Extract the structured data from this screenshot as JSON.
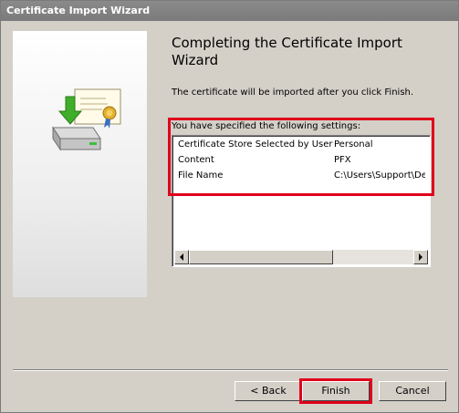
{
  "window": {
    "title": "Certificate Import Wizard"
  },
  "page": {
    "heading": "Completing the Certificate Import Wizard",
    "description": "The certificate will be imported after you click Finish.",
    "settings_label": "You have specified the following settings:"
  },
  "settings": [
    {
      "name": "Certificate Store Selected by User",
      "value": "Personal"
    },
    {
      "name": "Content",
      "value": "PFX"
    },
    {
      "name": "File Name",
      "value": "C:\\Users\\Support\\Des"
    }
  ],
  "buttons": {
    "back": "< Back",
    "finish": "Finish",
    "cancel": "Cancel"
  },
  "icons": {
    "wizard_art": "certificate-import-icon",
    "scroll_left": "arrow-left-icon",
    "scroll_right": "arrow-right-icon"
  },
  "colors": {
    "highlight": "#e0001b",
    "titlebar": "#808080",
    "dialog_bg": "#d4d0c8"
  }
}
